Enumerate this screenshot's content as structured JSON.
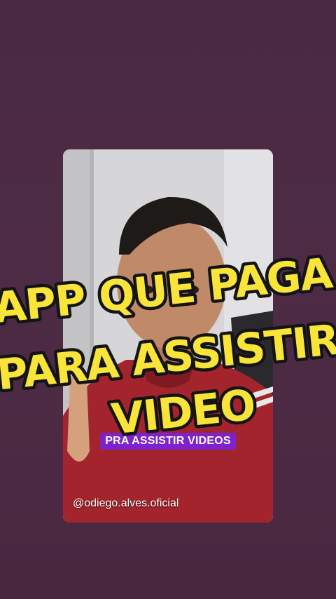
{
  "overlay_title": {
    "line1": "APP QUE PAGA",
    "line2": "PARA ASSISTIR",
    "line3": "VIDEO"
  },
  "video": {
    "caption": "PRA ASSISTIR VIDEOS",
    "handle": "@odiego.alves.oficial"
  },
  "colors": {
    "background": "#4a2a42",
    "title_fill": "#f9e43a",
    "title_stroke": "#141414",
    "caption_bg": "#7e22ce"
  }
}
